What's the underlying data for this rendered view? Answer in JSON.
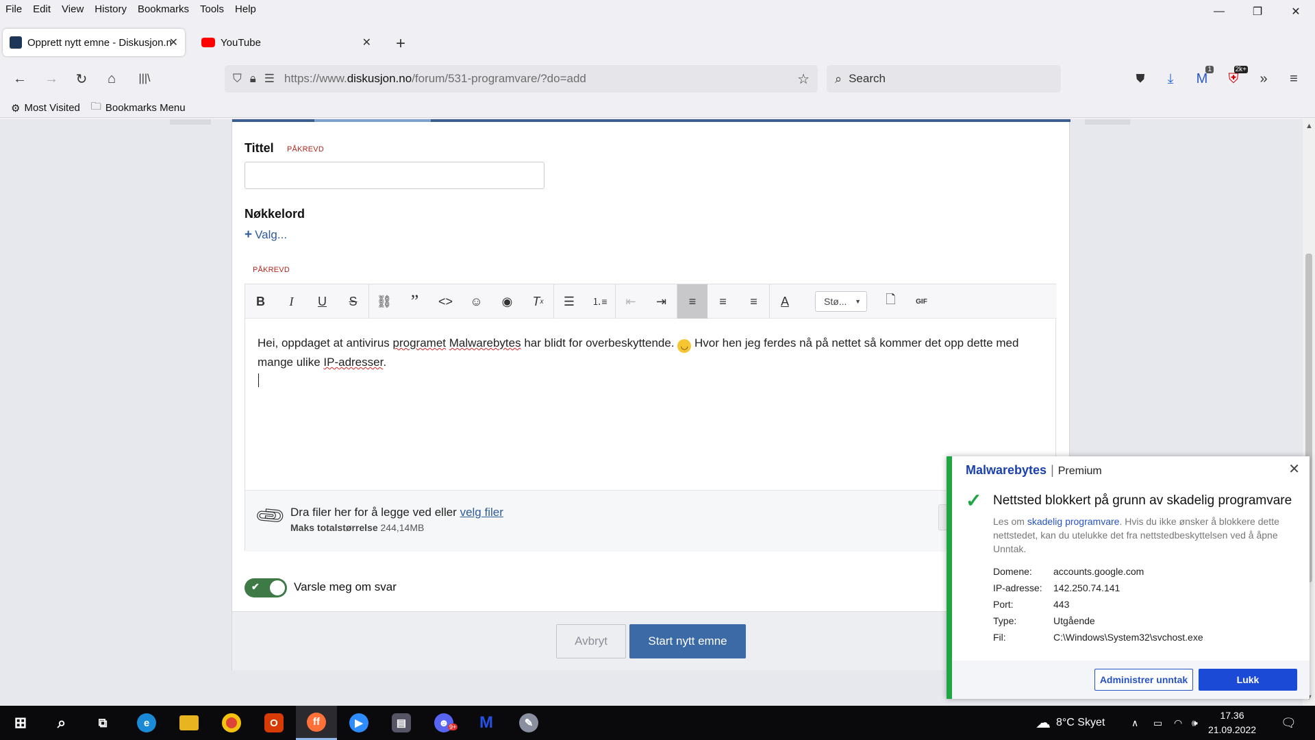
{
  "menu": [
    "File",
    "Edit",
    "View",
    "History",
    "Bookmarks",
    "Tools",
    "Help"
  ],
  "window_controls": {
    "minimize": "—",
    "restore": "❐",
    "close": "✕"
  },
  "tabs": [
    {
      "title": "Opprett nytt emne - Diskusjon.n",
      "favicon": "diskusjon-icon"
    },
    {
      "title": "YouTube",
      "favicon": "youtube-icon"
    }
  ],
  "nav": {
    "url_prefix": "https://www.",
    "url_domain": "diskusjon.no",
    "url_path": "/forum/531-programvare/?do=add",
    "search_placeholder": "Search"
  },
  "bookmarks": [
    "Most Visited",
    "Bookmarks Menu"
  ],
  "extensions": {
    "badge_count": "1",
    "badge_2k": "2k+"
  },
  "form": {
    "title_label": "Tittel",
    "required": "PÅKREVD",
    "keywords_label": "Nøkkelord",
    "keywords_choose": "Valg...",
    "editor_required": "PÅKREVD",
    "styles_dropdown": "Stø...",
    "body_text_1": "Hei, oppdaget at antivirus ",
    "body_word_1": "programet",
    "body_text_2": " ",
    "body_word_2": "Malwarebytes",
    "body_text_3": " har blidt for overbeskyttende. ",
    "body_text_4": " Hvor hen jeg ferdes nå på nettet så kommer det opp dette med mange ulike ",
    "body_word_3": "IP-adresser",
    "body_text_5": ".",
    "attach_text": "Dra filer her for å legge ved eller ",
    "attach_link": "velg filer",
    "max_label": "Maks totalstørrelse",
    "max_value": "244,14MB",
    "attach_button_partial": "L",
    "notify_label": "Varsle meg om svar",
    "notify_on": true,
    "cancel_button": "Avbryt",
    "submit_button": "Start nytt emne"
  },
  "malwarebytes": {
    "brand": "Malwarebytes",
    "tier": "Premium",
    "heading": "Nettsted blokkert på grunn av skadelig programvare",
    "desc_prefix": "Les om ",
    "desc_link": "skadelig programvare",
    "desc_rest": ". Hvis du ikke ønsker å blokkere dette nettstedet, kan du utelukke det fra nettstedbeskyttelsen ved å åpne Unntak.",
    "rows": [
      {
        "key": "Domene:",
        "value": "accounts.google.com"
      },
      {
        "key": "IP-adresse:",
        "value": "142.250.74.141"
      },
      {
        "key": "Port:",
        "value": "443"
      },
      {
        "key": "Type:",
        "value": "Utgående"
      },
      {
        "key": "Fil:",
        "value": "C:\\Windows\\System32\\svchost.exe"
      }
    ],
    "manage_button": "Administrer unntak",
    "close_button": "Lukk",
    "accent_color": "#1fa642"
  },
  "taskbar": {
    "weather": "8°C  Skyet",
    "time": "17.36",
    "date": "21.09.2022",
    "discord_badge": "9+"
  }
}
